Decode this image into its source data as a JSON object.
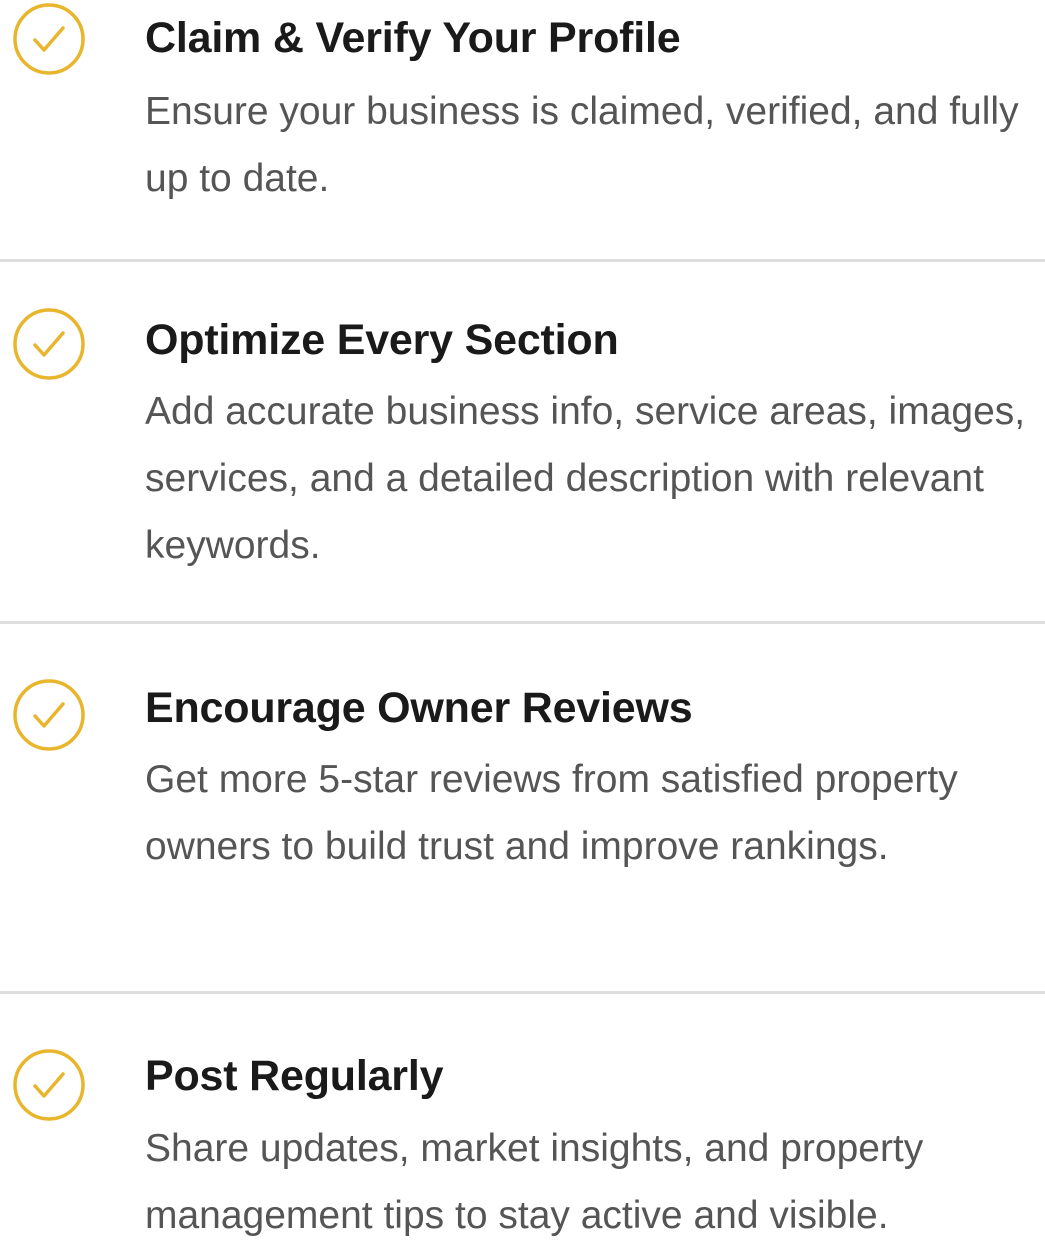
{
  "checklist": {
    "items": [
      {
        "title": "Claim & Verify Your Profile",
        "description": "Ensure your business is claimed, verified, and fully up to date."
      },
      {
        "title": "Optimize Every Section",
        "description": "Add accurate business info, service areas, images, services, and a detailed description with relevant keywords."
      },
      {
        "title": "Encourage Owner Reviews",
        "description": "Get more 5-star reviews from satisfied property owners to build trust and improve rankings."
      },
      {
        "title": "Post Regularly",
        "description": "Share updates, market insights, and property management tips to stay active and visible."
      }
    ],
    "icon": "check-circle-icon",
    "icon_color": "#e8b52c",
    "divider_color": "#dedede",
    "title_color": "#1a1a1a",
    "description_color": "#555555"
  }
}
